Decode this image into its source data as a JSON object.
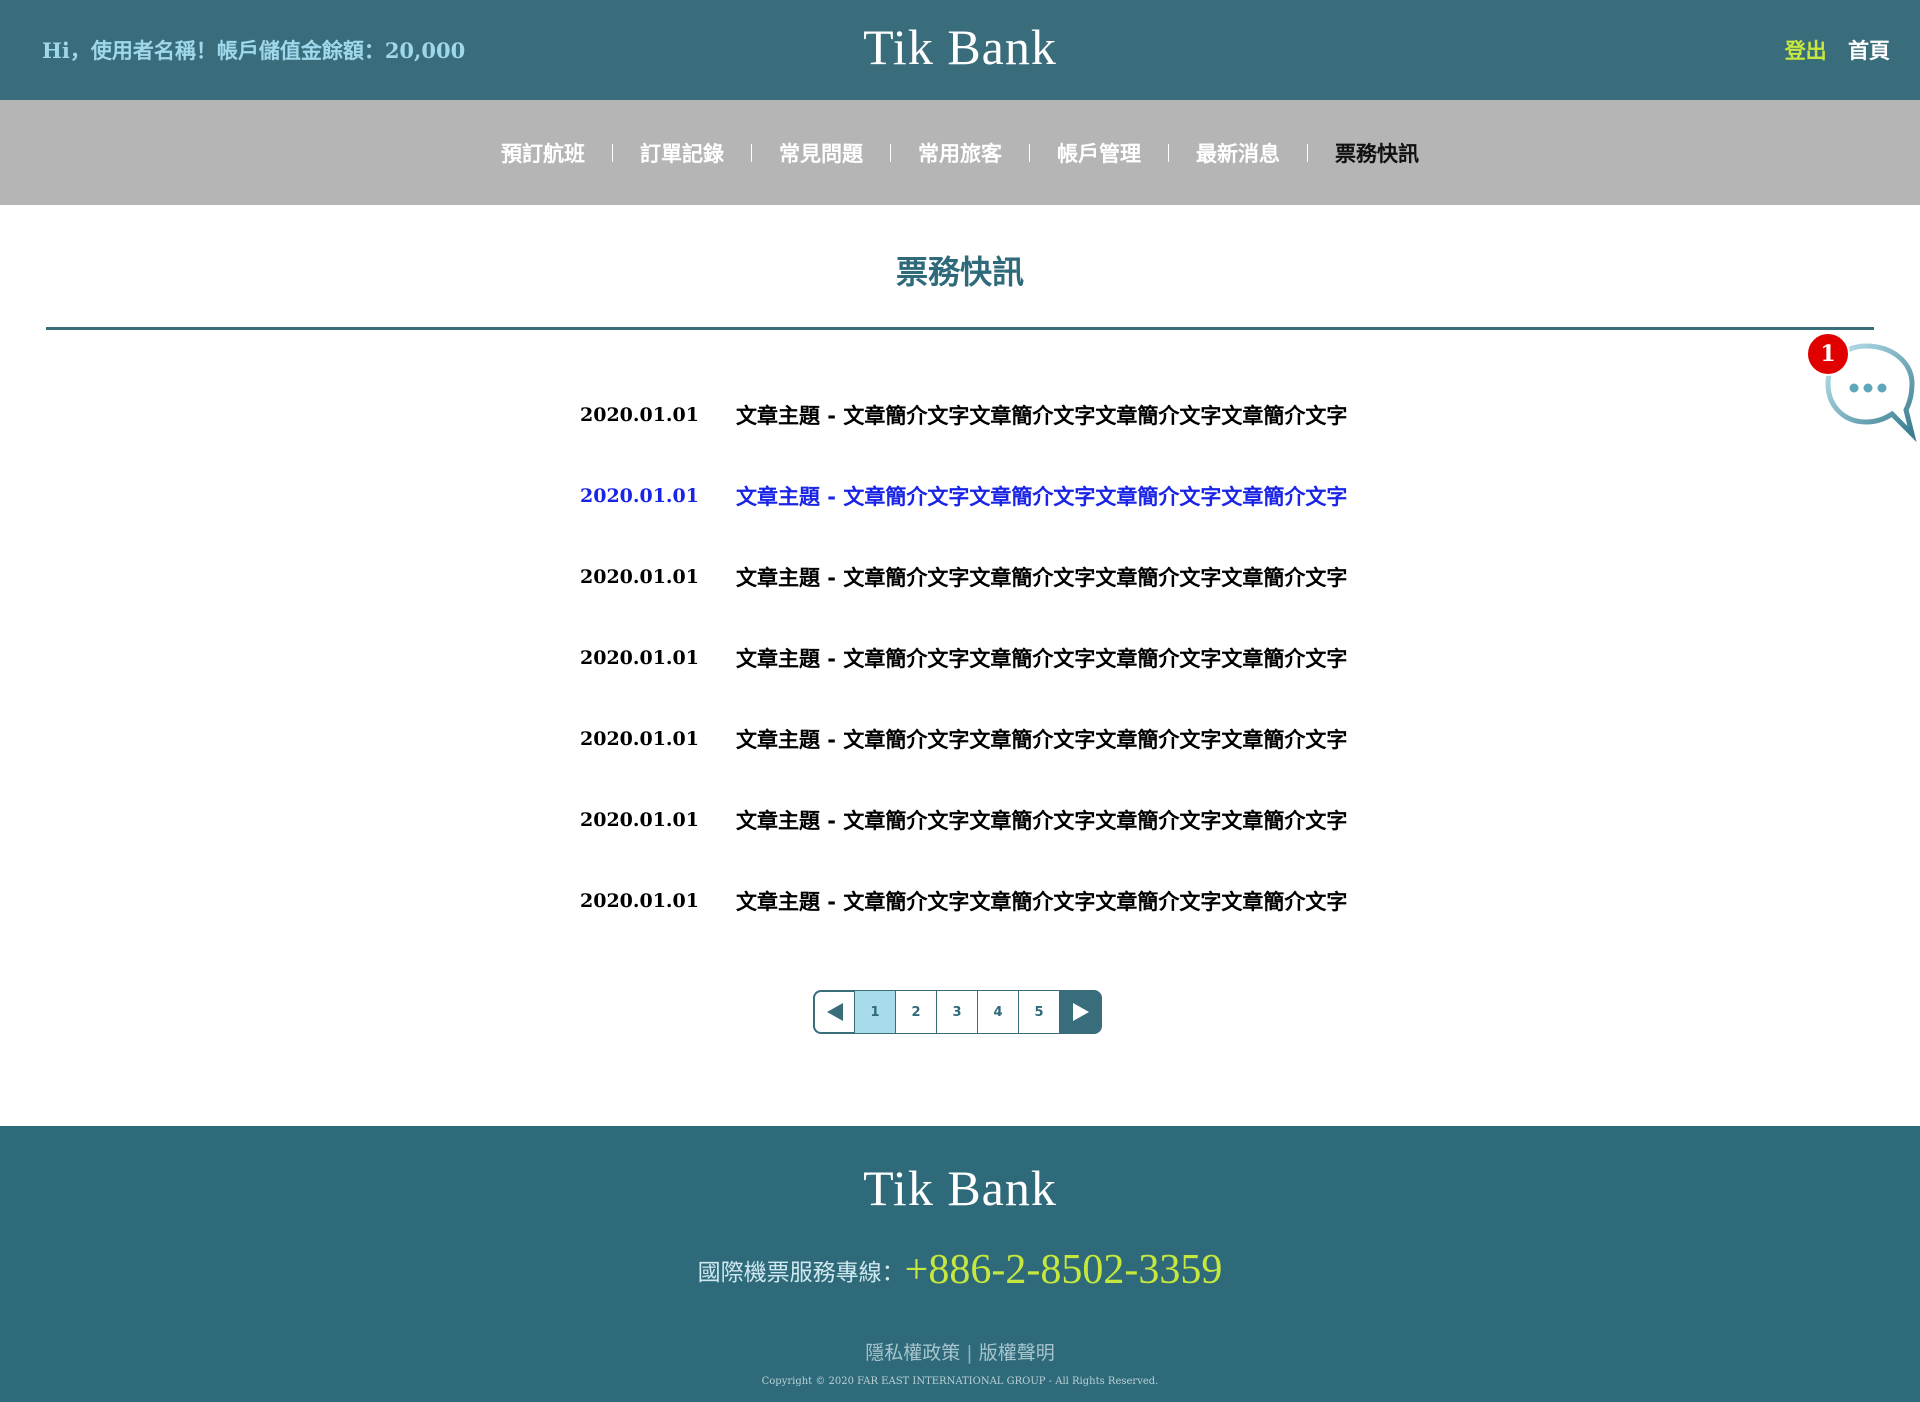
{
  "header": {
    "greeting": "Hi，使用者名稱！帳戶儲值金餘額：20,000",
    "brand": "Tik Bank",
    "logout_label": "登出",
    "home_label": "首頁"
  },
  "nav": {
    "items": [
      {
        "label": "預訂航班"
      },
      {
        "label": "訂單記錄"
      },
      {
        "label": "常見問題"
      },
      {
        "label": "常用旅客"
      },
      {
        "label": "帳戶管理"
      },
      {
        "label": "最新消息"
      },
      {
        "label": "票務快訊"
      }
    ],
    "active_label": "票務快訊"
  },
  "main": {
    "title": "票務快訊",
    "news": [
      {
        "date": "2020.01.01",
        "text": "文章主題 - 文章簡介文字文章簡介文字文章簡介文字文章簡介文字"
      },
      {
        "date": "2020.01.01",
        "text": "文章主題 - 文章簡介文字文章簡介文字文章簡介文字文章簡介文字"
      },
      {
        "date": "2020.01.01",
        "text": "文章主題 - 文章簡介文字文章簡介文字文章簡介文字文章簡介文字"
      },
      {
        "date": "2020.01.01",
        "text": "文章主題 - 文章簡介文字文章簡介文字文章簡介文字文章簡介文字"
      },
      {
        "date": "2020.01.01",
        "text": "文章主題 - 文章簡介文字文章簡介文字文章簡介文字文章簡介文字"
      },
      {
        "date": "2020.01.01",
        "text": "文章主題 - 文章簡介文字文章簡介文字文章簡介文字文章簡介文字"
      },
      {
        "date": "2020.01.01",
        "text": "文章主題 - 文章簡介文字文章簡介文字文章簡介文字文章簡介文字"
      }
    ],
    "pagination": {
      "pages": [
        "1",
        "2",
        "3",
        "4",
        "5"
      ],
      "current": "1",
      "prev_icon": "triangle-left-icon",
      "next_icon": "triangle-right-icon"
    }
  },
  "chat": {
    "badge_count": "1",
    "icon": "chat-bubble-icon"
  },
  "footer": {
    "brand": "Tik Bank",
    "hotline_label": "國際機票服務專線：",
    "hotline_number": "+886-2-8502-3359",
    "privacy_label": "隱私權政策",
    "copyright_label": "版權聲明",
    "copyright_text": "Copyright © 2020 FAR EAST INTERNATIONAL GROUP - All Rights Reserved."
  },
  "colors": {
    "header_bg": "#3a6d7c",
    "nav_bg": "#b5b5b5",
    "footer_bg": "#2e6a7a",
    "accent_green": "#c6e83e",
    "link_hover_blue": "#1a24e6",
    "badge_red": "#e00000"
  }
}
